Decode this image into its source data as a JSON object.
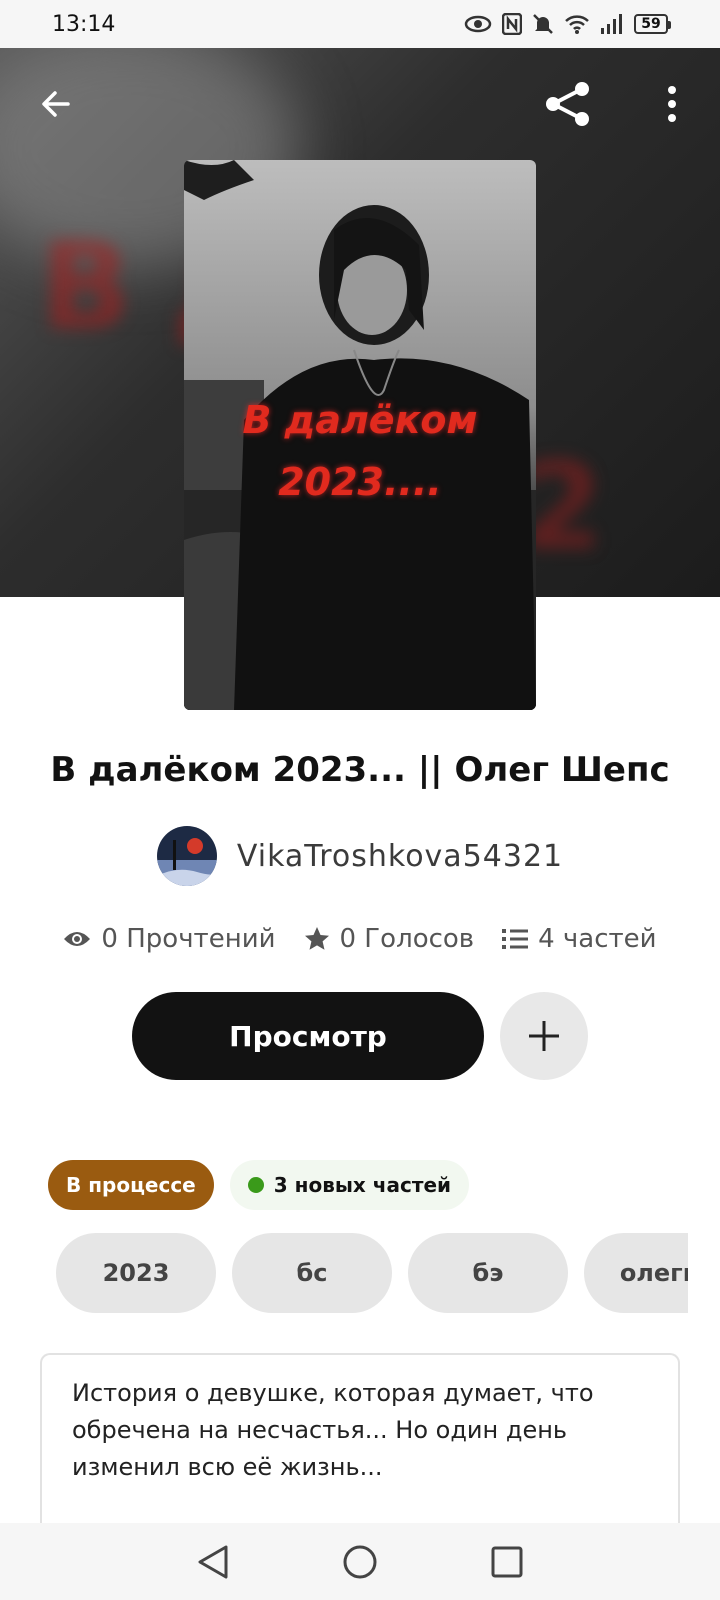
{
  "status_bar": {
    "time": "13:14",
    "battery": "59"
  },
  "cover": {
    "title_line1": "В далёком",
    "title_line2": "2023...."
  },
  "story": {
    "title": "В далёком 2023... || Олег Шепс",
    "author": "VikaTroshkova54321"
  },
  "stats": {
    "reads": "0 Прочтений",
    "votes": "0 Голосов",
    "parts": "4 частей"
  },
  "actions": {
    "read_label": "Просмотр"
  },
  "badges": {
    "status": "В процессе",
    "new_parts": "3 новых частей"
  },
  "tags": [
    "2023",
    "бс",
    "бэ",
    "олегш"
  ],
  "description": "История о девушке, которая думает, что обречена на несчастья... Но один день изменил всю её жизнь...",
  "colors": {
    "status_badge": "#9a5b10",
    "new_dot": "#3a9a1a",
    "primary_button": "#121212"
  }
}
